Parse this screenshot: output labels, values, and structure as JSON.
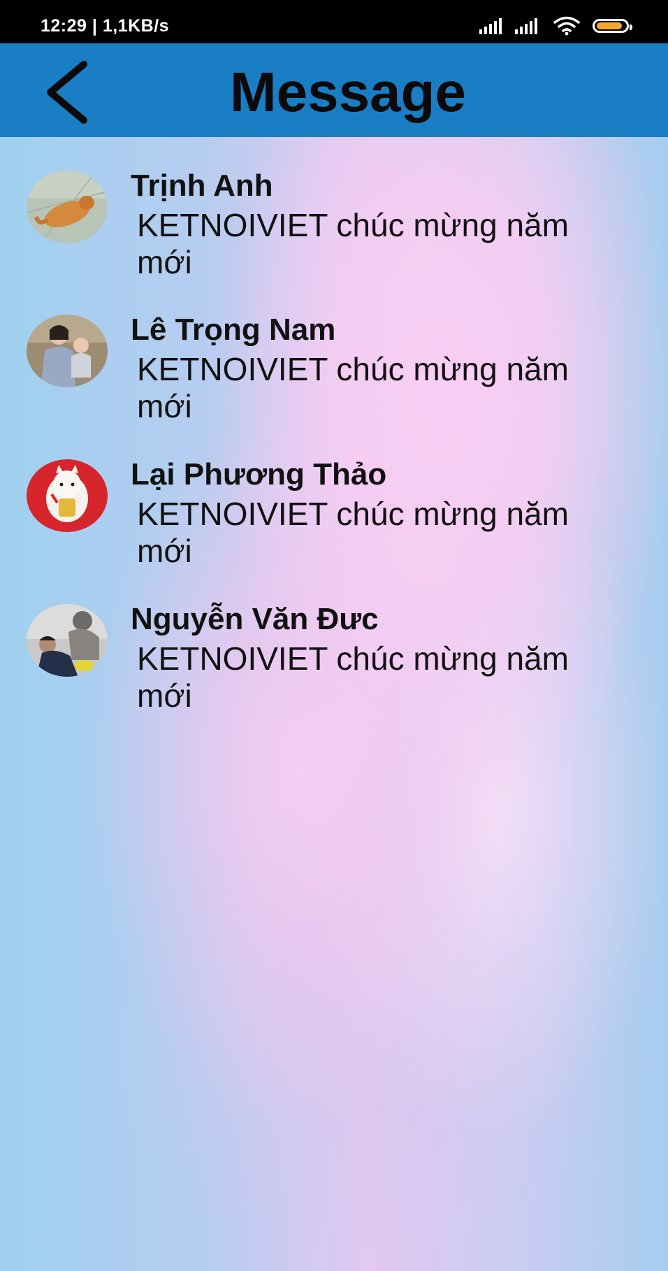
{
  "status_bar": {
    "time_and_speed": "12:29 | 1,1KB/s",
    "battery_level": 0.9,
    "accent_color": "#f2a92b"
  },
  "header": {
    "title": "Message",
    "back_icon": "chevron-left-icon",
    "background_color": "#1a7ec5"
  },
  "messages": [
    {
      "name": "Trịnh Anh",
      "preview": "KETNOIVIET chúc mừng năm mới",
      "avatar": "orange-cat-photo"
    },
    {
      "name": "Lê Trọng Nam",
      "preview": "KETNOIVIET chúc mừng năm mới",
      "avatar": "woman-holding-child-photo"
    },
    {
      "name": "Lại Phương Thảo",
      "preview": "KETNOIVIET chúc mừng năm mới",
      "avatar": "lucky-cat-photo"
    },
    {
      "name": "Nguyễn Văn Đưc",
      "preview": "KETNOIVIET chúc mừng năm mới",
      "avatar": "person-photo"
    }
  ]
}
